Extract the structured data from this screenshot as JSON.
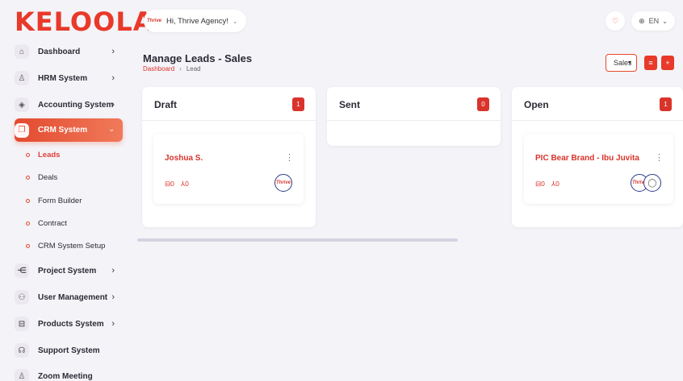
{
  "brand": {
    "logo": "KELOOLA",
    "accent": "#e8392a"
  },
  "topbar": {
    "greeting": "Hi, Thrive Agency!",
    "avatar_text": "Thrive",
    "language": "EN"
  },
  "sidebar": {
    "items": [
      {
        "label": "Dashboard",
        "icon": "home-icon"
      },
      {
        "label": "HRM System",
        "icon": "user-icon"
      },
      {
        "label": "Accounting System",
        "icon": "box-icon"
      },
      {
        "label": "CRM System",
        "icon": "layers-icon"
      },
      {
        "label": "Project System",
        "icon": "share-icon"
      },
      {
        "label": "User Management",
        "icon": "users-icon"
      },
      {
        "label": "Products System",
        "icon": "cart-icon"
      },
      {
        "label": "Support System",
        "icon": "headset-icon"
      },
      {
        "label": "Zoom Meeting",
        "icon": "user-plus-icon"
      }
    ],
    "crm_sub": [
      "Leads",
      "Deals",
      "Form Builder",
      "Contract",
      "CRM System Setup"
    ]
  },
  "header": {
    "title": "Manage Leads - Sales",
    "breadcrumb_home": "Dashboard",
    "breadcrumb_current": "Lead",
    "pipeline_select": "Sales"
  },
  "columns": [
    {
      "title": "Draft",
      "count": "1",
      "cards": [
        {
          "name": "Joshua S.",
          "products": "0",
          "sources": "0",
          "avatar": "Thrive"
        }
      ]
    },
    {
      "title": "Sent",
      "count": "0",
      "cards": []
    },
    {
      "title": "Open",
      "count": "1",
      "cards": [
        {
          "name": "PIC Bear Brand - Ibu Juvita",
          "products": "0",
          "sources": "0",
          "avatar": "Thrive"
        }
      ]
    }
  ]
}
